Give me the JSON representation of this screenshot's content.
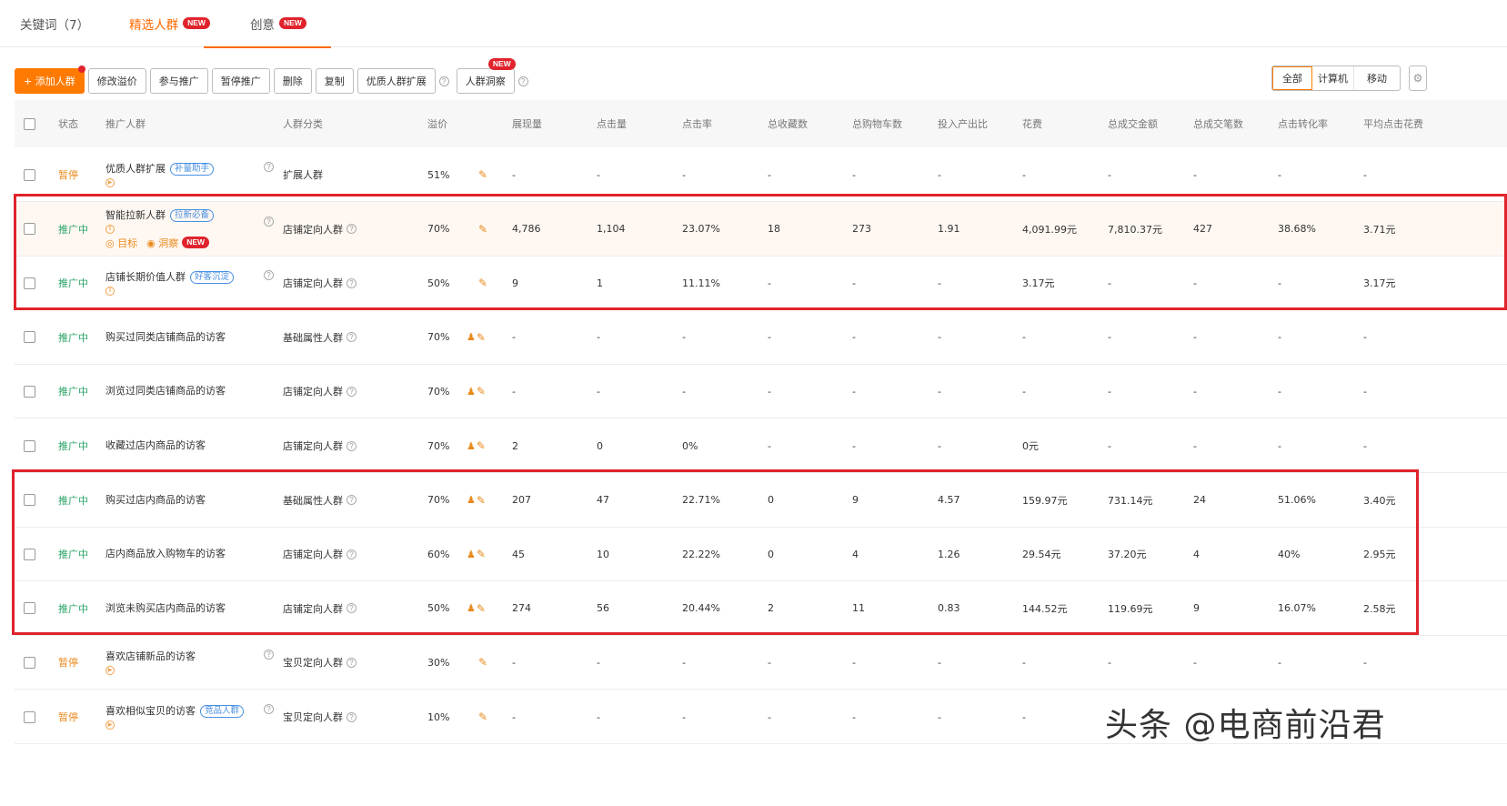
{
  "tabs": [
    {
      "label": "关键词（7）",
      "badge": ""
    },
    {
      "label": "精选人群",
      "badge": "NEW"
    },
    {
      "label": "创意",
      "badge": "NEW"
    }
  ],
  "toolbar": {
    "add": "+ 添加人群",
    "edit_premium": "修改溢价",
    "join": "参与推广",
    "pause": "暂停推广",
    "delete": "删除",
    "copy": "复制",
    "expand": "优质人群扩展",
    "insight": "人群洞察",
    "insight_badge": "NEW",
    "help": "?"
  },
  "device_filter": [
    "全部",
    "计算机",
    "移动"
  ],
  "columns": [
    "状态",
    "推广人群",
    "人群分类",
    "溢价",
    "展现量",
    "点击量",
    "点击率",
    "总收藏数",
    "总购物车数",
    "投入产出比",
    "花费",
    "总成交金额",
    "总成交笔数",
    "点击转化率",
    "平均点击花费"
  ],
  "rows": [
    {
      "status": "暂停",
      "name": "优质人群扩展",
      "tag": "补量助手",
      "category": "扩展人群",
      "premium": "51%",
      "impr": "-",
      "clicks": "-",
      "ctr": "-",
      "fav": "-",
      "cart": "-",
      "roi": "-",
      "cost": "-",
      "gmv": "-",
      "orders": "-",
      "cvr": "-",
      "cpc": "-"
    },
    {
      "status": "推广中",
      "name": "智能拉新人群",
      "tag": "拉新必备",
      "category": "店铺定向人群",
      "premium": "70%",
      "impr": "4,786",
      "clicks": "1,104",
      "ctr": "23.07%",
      "fav": "18",
      "cart": "273",
      "roi": "1.91",
      "cost": "4,091.99元",
      "gmv": "7,810.37元",
      "orders": "427",
      "cvr": "38.68%",
      "cpc": "3.71元",
      "sub_target": "目标",
      "sub_insight": "洞察",
      "sub_badge": "NEW"
    },
    {
      "status": "推广中",
      "name": "店铺长期价值人群",
      "tag": "好客沉淀",
      "category": "店铺定向人群",
      "premium": "50%",
      "impr": "9",
      "clicks": "1",
      "ctr": "11.11%",
      "fav": "-",
      "cart": "-",
      "roi": "-",
      "cost": "3.17元",
      "gmv": "-",
      "orders": "-",
      "cvr": "-",
      "cpc": "3.17元"
    },
    {
      "status": "推广中",
      "name": "购买过同类店铺商品的访客",
      "tag": "",
      "category": "基础属性人群",
      "premium": "70%",
      "impr": "-",
      "clicks": "-",
      "ctr": "-",
      "fav": "-",
      "cart": "-",
      "roi": "-",
      "cost": "-",
      "gmv": "-",
      "orders": "-",
      "cvr": "-",
      "cpc": "-"
    },
    {
      "status": "推广中",
      "name": "浏览过同类店铺商品的访客",
      "tag": "",
      "category": "店铺定向人群",
      "premium": "70%",
      "impr": "-",
      "clicks": "-",
      "ctr": "-",
      "fav": "-",
      "cart": "-",
      "roi": "-",
      "cost": "-",
      "gmv": "-",
      "orders": "-",
      "cvr": "-",
      "cpc": "-"
    },
    {
      "status": "推广中",
      "name": "收藏过店内商品的访客",
      "tag": "",
      "category": "店铺定向人群",
      "premium": "70%",
      "impr": "2",
      "clicks": "0",
      "ctr": "0%",
      "fav": "-",
      "cart": "-",
      "roi": "-",
      "cost": "0元",
      "gmv": "-",
      "orders": "-",
      "cvr": "-",
      "cpc": "-"
    },
    {
      "status": "推广中",
      "name": "购买过店内商品的访客",
      "tag": "",
      "category": "基础属性人群",
      "premium": "70%",
      "impr": "207",
      "clicks": "47",
      "ctr": "22.71%",
      "fav": "0",
      "cart": "9",
      "roi": "4.57",
      "cost": "159.97元",
      "gmv": "731.14元",
      "orders": "24",
      "cvr": "51.06%",
      "cpc": "3.40元"
    },
    {
      "status": "推广中",
      "name": "店内商品放入购物车的访客",
      "tag": "",
      "category": "店铺定向人群",
      "premium": "60%",
      "impr": "45",
      "clicks": "10",
      "ctr": "22.22%",
      "fav": "0",
      "cart": "4",
      "roi": "1.26",
      "cost": "29.54元",
      "gmv": "37.20元",
      "orders": "4",
      "cvr": "40%",
      "cpc": "2.95元"
    },
    {
      "status": "推广中",
      "name": "浏览未购买店内商品的访客",
      "tag": "",
      "category": "店铺定向人群",
      "premium": "50%",
      "impr": "274",
      "clicks": "56",
      "ctr": "20.44%",
      "fav": "2",
      "cart": "11",
      "roi": "0.83",
      "cost": "144.52元",
      "gmv": "119.69元",
      "orders": "9",
      "cvr": "16.07%",
      "cpc": "2.58元"
    },
    {
      "status": "暂停",
      "name": "喜欢店铺新品的访客",
      "tag": "",
      "category": "宝贝定向人群",
      "premium": "30%",
      "impr": "-",
      "clicks": "-",
      "ctr": "-",
      "fav": "-",
      "cart": "-",
      "roi": "-",
      "cost": "-",
      "gmv": "-",
      "orders": "-",
      "cvr": "-",
      "cpc": "-"
    },
    {
      "status": "暂停",
      "name": "喜欢相似宝贝的访客",
      "tag": "竞品人群",
      "category": "宝贝定向人群",
      "premium": "10%",
      "impr": "-",
      "clicks": "-",
      "ctr": "-",
      "fav": "-",
      "cart": "-",
      "roi": "-",
      "cost": "-",
      "gmv": "",
      "orders": "",
      "cvr": "",
      "cpc": ""
    }
  ],
  "watermark": "头条 @电商前沿君",
  "colors": {
    "accent": "#ff6a00",
    "running": "#2aa567",
    "paused": "#e98a1e",
    "highlight": "#e0232c"
  }
}
